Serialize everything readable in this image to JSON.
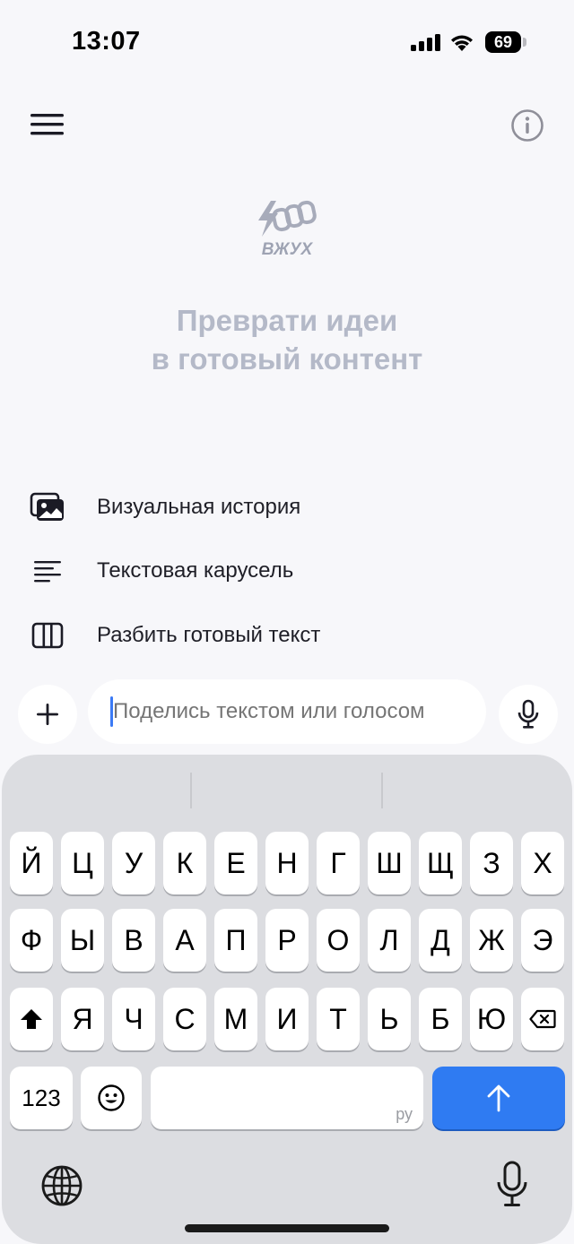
{
  "status_bar": {
    "time": "13:07",
    "battery": "69"
  },
  "app": {
    "logo_text": "ВЖУХ",
    "headline_line1": "Преврати идеи",
    "headline_line2": "в готовый контент"
  },
  "options": [
    {
      "label": "Визуальная история",
      "icon": "gallery-icon"
    },
    {
      "label": "Текстовая карусель",
      "icon": "text-lines-icon"
    },
    {
      "label": "Разбить готовый текст",
      "icon": "columns-icon"
    }
  ],
  "composer": {
    "placeholder": "Поделись текстом или голосом"
  },
  "keyboard": {
    "row1": [
      "Й",
      "Ц",
      "У",
      "К",
      "Е",
      "Н",
      "Г",
      "Ш",
      "Щ",
      "З",
      "Х"
    ],
    "row2": [
      "Ф",
      "Ы",
      "В",
      "А",
      "П",
      "Р",
      "О",
      "Л",
      "Д",
      "Ж",
      "Э"
    ],
    "row3": [
      "Я",
      "Ч",
      "С",
      "М",
      "И",
      "Т",
      "Ь",
      "Б",
      "Ю"
    ],
    "numbers_label": "123",
    "space_lang_hint": "ру"
  },
  "colors": {
    "accent": "#2f7bf2",
    "headline": "#b4b9c8",
    "background": "#f7f7fa",
    "keyboard_bg": "#dcdde1"
  }
}
